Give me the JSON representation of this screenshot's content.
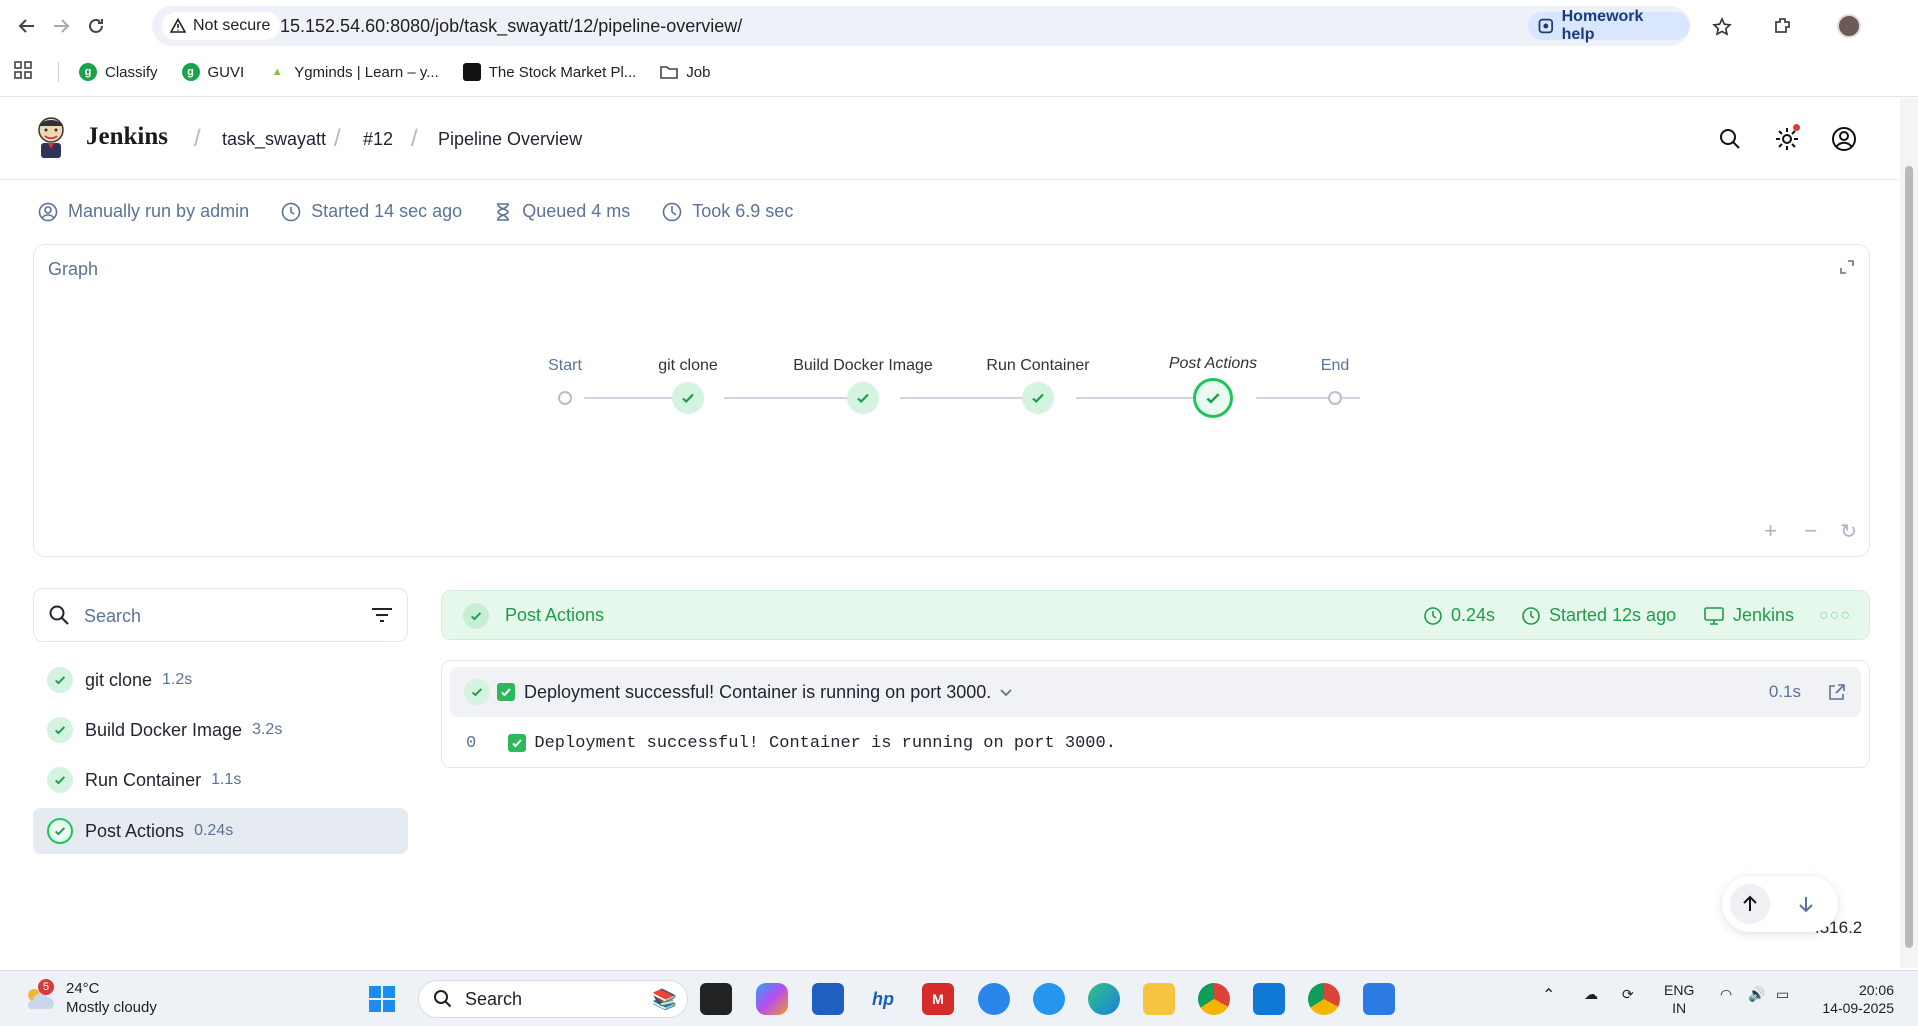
{
  "browser": {
    "security_label": "Not secure",
    "url": "15.152.54.60:8080/job/task_swayatt/12/pipeline-overview/",
    "homework_label": "Homework help",
    "bookmarks": [
      {
        "label": "Classify",
        "color": "#1aa34a"
      },
      {
        "label": "GUVI",
        "color": "#1aa34a"
      },
      {
        "label": "Ygminds | Learn – y...",
        "color": "#7ec23d"
      },
      {
        "label": "The Stock Market Pl...",
        "color": "#111111"
      },
      {
        "label": "Job",
        "color": "#444444"
      }
    ]
  },
  "header": {
    "brand": "Jenkins",
    "breadcrumbs": [
      "task_swayatt",
      "#12",
      "Pipeline Overview"
    ]
  },
  "run_info": {
    "triggered": "Manually run by admin",
    "started": "Started 14 sec ago",
    "queued": "Queued 4 ms",
    "took": "Took 6.9 sec"
  },
  "graph": {
    "title": "Graph",
    "stages": [
      "Start",
      "git clone",
      "Build Docker Image",
      "Run Container",
      "Post Actions",
      "End"
    ],
    "controls": {
      "zoom_in": "+",
      "zoom_out": "−",
      "reset": "↻"
    }
  },
  "stage_list": {
    "search_placeholder": "Search",
    "items": [
      {
        "name": "git clone",
        "duration": "1.2s"
      },
      {
        "name": "Build Docker Image",
        "duration": "3.2s"
      },
      {
        "name": "Run Container",
        "duration": "1.1s"
      },
      {
        "name": "Post Actions",
        "duration": "0.24s"
      }
    ]
  },
  "stage_detail": {
    "title": "Post Actions",
    "duration": "0.24s",
    "started": "Started 12s ago",
    "agent": "Jenkins",
    "more": "○○○",
    "step": {
      "text": "Deployment successful! Container is running on port 3000.",
      "duration": "0.1s"
    },
    "log": {
      "line_number": "0",
      "text": "Deployment successful! Container is running on port 3000."
    }
  },
  "version": ".516.2",
  "taskbar": {
    "weather_badge": "5",
    "temperature": "24°C",
    "condition": "Mostly cloudy",
    "search_label": "Search",
    "lang_top": "ENG",
    "lang_bottom": "IN",
    "time": "20:06",
    "date": "14-09-2025"
  },
  "colors": {
    "success_green": "#1ec55a",
    "success_text": "#1e9c4e",
    "muted_blue": "#5b7396",
    "header_bg": "#e6f8ec"
  }
}
